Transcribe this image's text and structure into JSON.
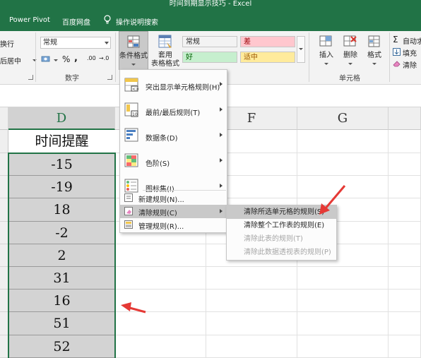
{
  "window": {
    "title": "时间到期显示技巧  -  Excel"
  },
  "tabs": [
    {
      "label": "Power Pivot"
    },
    {
      "label": "百度网盘"
    },
    {
      "label": "操作说明搜索"
    }
  ],
  "ribbon": {
    "alignment": {
      "wrap": "换行",
      "merge": "后居中"
    },
    "number": {
      "format_value": "常规",
      "percent": "%",
      "comma": ",",
      "inc_decimal": ".00",
      "dec_decimal": "→.0",
      "group_label": "数字"
    },
    "styles": {
      "conditional_format": "条件格式",
      "table_format_line1": "套用",
      "table_format_line2": "表格格式",
      "cells": [
        {
          "label": "常规",
          "bg": "#ffffff"
        },
        {
          "label": "差",
          "bg": "#ffc7ce"
        },
        {
          "label": "好",
          "bg": "#c6efce"
        },
        {
          "label": "适中",
          "bg": "#ffeb9c"
        }
      ]
    },
    "cells_group": {
      "insert": "插入",
      "delete": "删除",
      "format": "格式",
      "group_label": "单元格"
    },
    "editing": {
      "autosum": "自动求",
      "fill": "填充",
      "clear": "清除"
    }
  },
  "grid": {
    "columns": [
      "D",
      "F",
      "G"
    ],
    "header_cell": "时间提醒",
    "values": [
      "-15",
      "-19",
      "18",
      "-2",
      "2",
      "31",
      "16",
      "51",
      "52"
    ]
  },
  "cf_menu": {
    "items": [
      {
        "label": "突出显示单元格规则(H)",
        "submenu": true
      },
      {
        "label": "最前/最后规则(T)",
        "submenu": true
      },
      {
        "label": "数据条(D)",
        "submenu": true
      },
      {
        "label": "色阶(S)",
        "submenu": true
      },
      {
        "label": "图标集(I)",
        "submenu": true
      },
      {
        "label": "新建规则(N)..."
      },
      {
        "label": "清除规则(C)",
        "submenu": true
      },
      {
        "label": "管理规则(R)..."
      }
    ]
  },
  "clear_submenu": {
    "items": [
      {
        "label": "清除所选单元格的规则(S)",
        "enabled": true
      },
      {
        "label": "清除整个工作表的规则(E)",
        "enabled": true
      },
      {
        "label": "清除此表的规则(T)",
        "enabled": false
      },
      {
        "label": "清除此数据透视表的规则(P)",
        "enabled": false
      }
    ]
  },
  "annotation_color": "#e53935"
}
